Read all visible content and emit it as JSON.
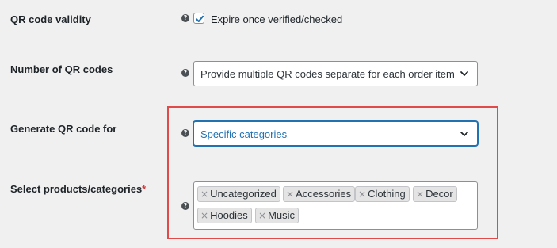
{
  "rows": {
    "validity": {
      "label": "QR code validity",
      "help": "?",
      "checkbox_label": "Expire once verified/checked",
      "checked": true
    },
    "number": {
      "label": "Number of QR codes",
      "help": "?",
      "selected": "Provide multiple QR codes separate for each order item"
    },
    "generate": {
      "label": "Generate QR code for",
      "help": "?",
      "selected": "Specific categories"
    },
    "select_products": {
      "label": "Select products/categories",
      "required_mark": "*",
      "help": "?",
      "chip_remove": "×",
      "chips": [
        "Uncategorized",
        "Accessories",
        "Clothing",
        "Decor",
        "Hoodies",
        "Music"
      ]
    }
  },
  "icons": {
    "help": "help-icon",
    "check": "checkmark-icon",
    "chevron": "chevron-down-icon",
    "remove": "remove-x-icon"
  },
  "colors": {
    "background": "#f0f0f1",
    "accent": "#2271b1",
    "highlight": "#e04a4a",
    "required": "#d63638"
  }
}
